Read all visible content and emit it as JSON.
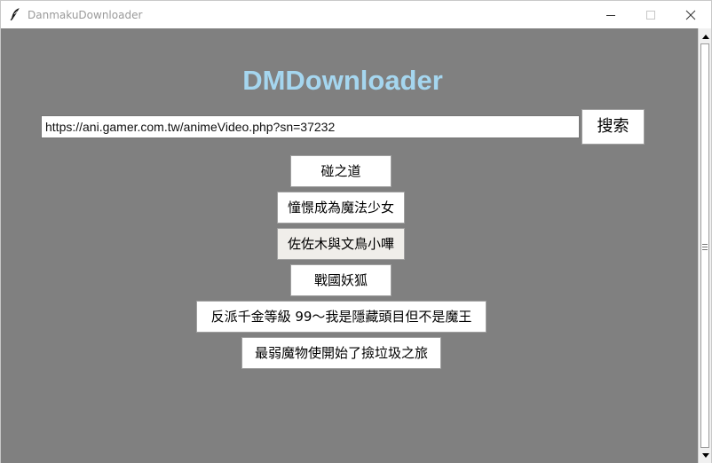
{
  "window": {
    "title": "DanmakuDownloader",
    "icon": "feather-icon"
  },
  "app": {
    "heading": "DMDownloader",
    "url_value": "https://ani.gamer.com.tw/animeVideo.php?sn=37232",
    "search_label": "搜索"
  },
  "results": [
    {
      "label": "碰之道"
    },
    {
      "label": "憧憬成為魔法少女"
    },
    {
      "label": "佐佐木與文鳥小嗶"
    },
    {
      "label": "戰國妖狐"
    },
    {
      "label": "反派千金等級 99～我是隱藏頭目但不是魔王"
    },
    {
      "label": "最弱魔物使開始了撿垃圾之旅"
    }
  ],
  "colors": {
    "content_background": "#808080",
    "heading": "#a5d6ef",
    "button_background": "#ffffff",
    "selected_button_background": "#f0eeea"
  }
}
